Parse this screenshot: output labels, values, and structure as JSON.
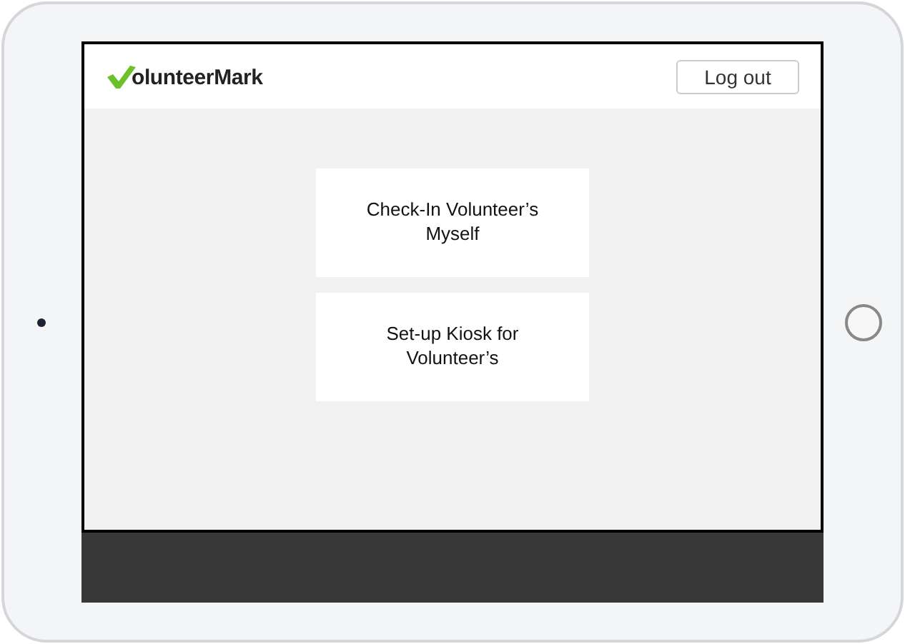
{
  "header": {
    "logo_text": "olunteerMark",
    "logout_button": "Log out"
  },
  "actions": [
    {
      "label": "Check-In Volunteer’s Myself"
    },
    {
      "label": "Set-up Kiosk for Volunteer’s"
    }
  ]
}
